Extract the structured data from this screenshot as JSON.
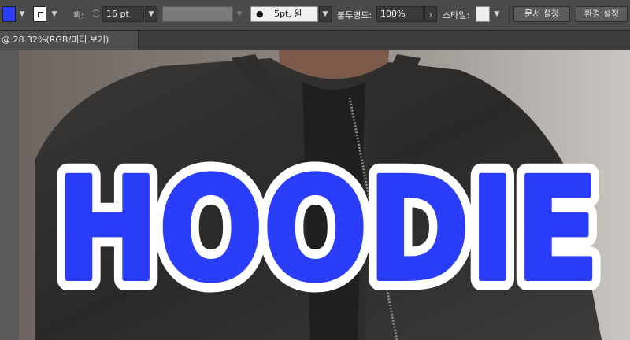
{
  "toolbar": {
    "fill_color": "#2a3dfa",
    "stroke_color": "#ffffff",
    "stroke_label": "획:",
    "stroke_weight": "16 pt",
    "brush_label": "5pt. 원",
    "opacity_label": "불투명도:",
    "opacity_value": "100%",
    "style_label": "스타일:",
    "document_setup_button": "문서 설정",
    "preferences_button": "환경 설정"
  },
  "tab": {
    "title": "@ 28.32%(RGB/미리 보기)"
  },
  "canvas": {
    "artwork_text": "HOODIE",
    "text_fill": "#2a3dfa",
    "text_stroke": "#ffffff"
  }
}
